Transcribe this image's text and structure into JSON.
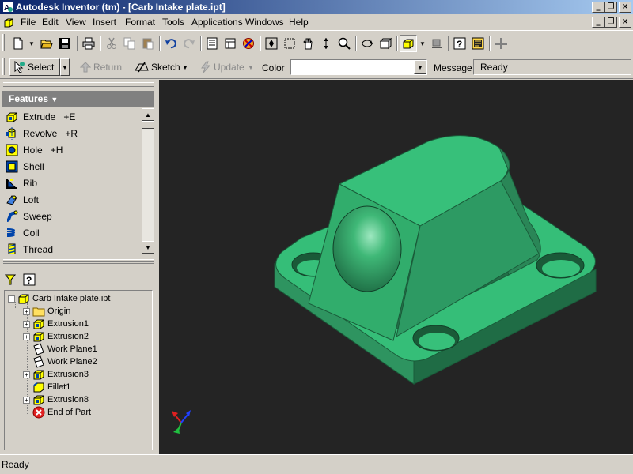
{
  "window": {
    "title": "Autodesk Inventor (tm) - [Carb Intake plate.ipt]",
    "min_glyph": "_",
    "restore_glyph": "❐",
    "close_glyph": "×"
  },
  "menu": {
    "items": [
      "File",
      "Edit",
      "View",
      "Insert",
      "Format",
      "Tools",
      "Applications",
      "Windows",
      "Help"
    ]
  },
  "toolbar": {
    "buttons": [
      "new-icon",
      "open-icon",
      "save-icon",
      "print-icon",
      "cut-icon",
      "copy-icon",
      "paste-icon",
      "undo-icon",
      "redo-icon",
      "zoom-all-icon",
      "zoom-window-icon",
      "zoom-icon",
      "pan-icon",
      "zoom-selected-icon",
      "rotate-icon",
      "look-at-icon",
      "shaded-display-icon",
      "ground-shadow-icon",
      "help-icon",
      "macro-icon",
      "add-icon"
    ]
  },
  "commandbar": {
    "select_label": "Select",
    "return_label": "Return",
    "sketch_label": "Sketch",
    "update_label": "Update",
    "color_label": "Color",
    "color_value": "",
    "message_label": "Message",
    "message_value": "Ready"
  },
  "features": {
    "header": "Features",
    "items": [
      {
        "label": "Extrude",
        "shortcut": "+E"
      },
      {
        "label": "Revolve",
        "shortcut": "+R"
      },
      {
        "label": "Hole",
        "shortcut": "+H"
      },
      {
        "label": "Shell",
        "shortcut": ""
      },
      {
        "label": "Rib",
        "shortcut": ""
      },
      {
        "label": "Loft",
        "shortcut": ""
      },
      {
        "label": "Sweep",
        "shortcut": ""
      },
      {
        "label": "Coil",
        "shortcut": ""
      },
      {
        "label": "Thread",
        "shortcut": ""
      }
    ]
  },
  "browser": {
    "root": "Carb Intake plate.ipt",
    "nodes": [
      {
        "label": "Origin",
        "type": "folder"
      },
      {
        "label": "Extrusion1",
        "type": "extrusion"
      },
      {
        "label": "Extrusion2",
        "type": "extrusion"
      },
      {
        "label": "Work Plane1",
        "type": "workplane"
      },
      {
        "label": "Work Plane2",
        "type": "workplane"
      },
      {
        "label": "Extrusion3",
        "type": "extrusion"
      },
      {
        "label": "Fillet1",
        "type": "fillet"
      },
      {
        "label": "Extrusion8",
        "type": "extrusion"
      },
      {
        "label": "End of Part",
        "type": "end"
      }
    ]
  },
  "colors": {
    "part_green": "#33bb77",
    "viewport_bg": "#242424"
  },
  "status": {
    "text": "Ready"
  }
}
